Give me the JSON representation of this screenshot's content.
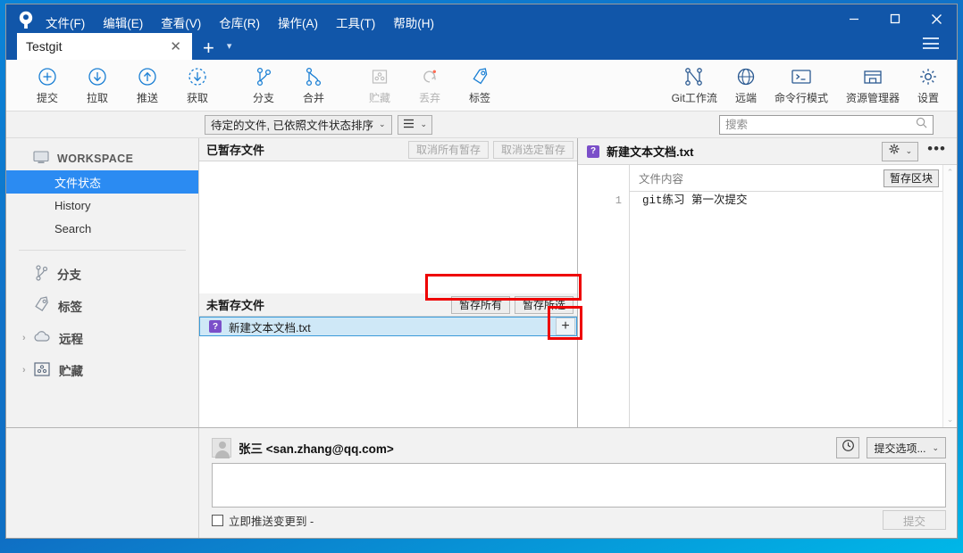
{
  "window": {
    "title": "Testgit",
    "controls": {
      "minimize": "minimize-icon",
      "maximize": "maximize-icon",
      "close": "close-icon",
      "menu": "hamburger-icon"
    }
  },
  "menubar": {
    "items": [
      "文件(F)",
      "编辑(E)",
      "查看(V)",
      "仓库(R)",
      "操作(A)",
      "工具(T)",
      "帮助(H)"
    ]
  },
  "tabs": {
    "active": "Testgit",
    "close_label": "✕",
    "add_label": "+",
    "dropdown_label": "▾"
  },
  "toolbar": {
    "left": [
      {
        "label": "提交",
        "icon": "commit-plus-icon",
        "disabled": false
      },
      {
        "label": "拉取",
        "icon": "pull-down-arrow-icon",
        "disabled": false
      },
      {
        "label": "推送",
        "icon": "push-up-arrow-icon",
        "disabled": false
      },
      {
        "label": "获取",
        "icon": "fetch-dashed-arrow-icon",
        "disabled": false
      },
      {
        "label": "分支",
        "icon": "branch-icon",
        "disabled": false
      },
      {
        "label": "合并",
        "icon": "merge-icon",
        "disabled": false
      },
      {
        "label": "贮藏",
        "icon": "stash-box-icon",
        "disabled": true
      },
      {
        "label": "丢弃",
        "icon": "discard-refresh-icon",
        "disabled": true
      },
      {
        "label": "标签",
        "icon": "tag-icon",
        "disabled": false
      }
    ],
    "right": [
      {
        "label": "Git工作流",
        "icon": "gitflow-icon"
      },
      {
        "label": "远端",
        "icon": "globe-icon"
      },
      {
        "label": "命令行模式",
        "icon": "terminal-icon"
      },
      {
        "label": "资源管理器",
        "icon": "folder-explorer-icon"
      },
      {
        "label": "设置",
        "icon": "gear-icon"
      }
    ]
  },
  "subbar": {
    "sort_label": "待定的文件, 已依照文件状态排序",
    "sort_caret": "⌄",
    "view_icon": "list-lines-icon",
    "view_caret": "⌄",
    "search_placeholder": "搜索",
    "search_value": "",
    "search_icon": "search-icon"
  },
  "sidebar": {
    "workspace_label": "WORKSPACE",
    "workspace_icon": "monitor-icon",
    "items": [
      {
        "label": "文件状态",
        "active": true
      },
      {
        "label": "History",
        "active": false
      },
      {
        "label": "Search",
        "active": false
      }
    ],
    "sections": [
      {
        "label": "分支",
        "icon": "branch-icon",
        "collapsible": false
      },
      {
        "label": "标签",
        "icon": "tag-icon",
        "collapsible": false
      },
      {
        "label": "远程",
        "icon": "cloud-icon",
        "collapsible": true,
        "arrow": "›"
      },
      {
        "label": "贮藏",
        "icon": "stash-box-icon",
        "collapsible": true,
        "arrow": "›"
      }
    ]
  },
  "staged": {
    "title": "已暂存文件",
    "buttons": [
      {
        "label": "取消所有暂存",
        "disabled": true
      },
      {
        "label": "取消选定暂存",
        "disabled": true
      }
    ],
    "files": []
  },
  "unstaged": {
    "title": "未暂存文件",
    "buttons": [
      {
        "label": "暂存所有",
        "disabled": false
      },
      {
        "label": "暂存所选",
        "disabled": false
      }
    ],
    "files": [
      {
        "name": "新建文本文档.txt",
        "status_badge": "?",
        "status_color": "#7b4fc9",
        "selected": true,
        "stage_button": "+"
      }
    ]
  },
  "diff": {
    "filename": "新建文本文档.txt",
    "status_badge": "?",
    "gear_icon": "gear-icon",
    "gear_caret": "⌄",
    "more_icon": "more-dots-icon",
    "column_header": "文件内容",
    "hunk_button": "暂存区块",
    "lines": [
      {
        "number": "1",
        "text": "git练习 第一次提交"
      }
    ]
  },
  "commit": {
    "author_name": "张三",
    "author_email": "<san.zhang@qq.com>",
    "avatar_icon": "avatar-icon",
    "history_icon": "clock-icon",
    "options_label": "提交选项...",
    "options_caret": "⌄",
    "message_value": "",
    "message_placeholder": "",
    "push_checkbox_label": "立即推送变更到 -",
    "push_checked": false,
    "commit_button": "提交",
    "commit_button_disabled": true
  },
  "annotations": {
    "accent_color": "#ee0000",
    "boxes": [
      {
        "name": "stage-buttons-highlight"
      },
      {
        "name": "stage-plus-highlight"
      }
    ]
  }
}
